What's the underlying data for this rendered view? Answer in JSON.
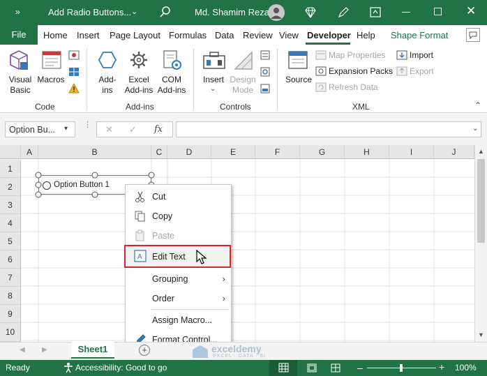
{
  "titlebar": {
    "doc_title": "Add Radio Buttons...",
    "user_name": "Md. Shamim Reza"
  },
  "ribbon_tabs": [
    "File",
    "Home",
    "Insert",
    "Page Layout",
    "Formulas",
    "Data",
    "Review",
    "View",
    "Developer",
    "Help",
    "Shape Format"
  ],
  "ribbon": {
    "code": {
      "group": "Code",
      "visual_basic": "Visual Basic",
      "macros": "Macros"
    },
    "addins": {
      "group": "Add-ins",
      "addins": "Add-ins",
      "excel_addins": "Excel Add-ins",
      "com_addins": "COM Add-ins"
    },
    "controls": {
      "group": "Controls",
      "insert": "Insert",
      "design_mode": "Design Mode"
    },
    "xml": {
      "group": "XML",
      "source": "Source",
      "map_properties": "Map Properties",
      "expansion_packs": "Expansion Packs",
      "refresh_data": "Refresh Data",
      "import": "Import",
      "export": "Export"
    }
  },
  "formula_bar": {
    "name_box": "Option Bu...",
    "fx": "fx",
    "value": ""
  },
  "columns": [
    "A",
    "B",
    "C",
    "D",
    "E",
    "F",
    "G",
    "H",
    "I",
    "J"
  ],
  "rows": [
    "1",
    "2",
    "3",
    "4",
    "5",
    "6",
    "7",
    "8",
    "9",
    "10"
  ],
  "control": {
    "label": "Option Button 1"
  },
  "context_menu": {
    "cut": "Cut",
    "copy": "Copy",
    "paste": "Paste",
    "edit_text": "Edit Text",
    "grouping": "Grouping",
    "order": "Order",
    "assign_macro": "Assign Macro...",
    "format_control": "Format Control..."
  },
  "sheet_tabs": [
    "Sheet1"
  ],
  "statusbar": {
    "ready": "Ready",
    "accessibility": "Accessibility: Good to go",
    "zoom": "100%"
  },
  "watermark": {
    "brand": "exceldemy",
    "tagline": "EXCEL · DATA · BI"
  },
  "colors": {
    "excel_green": "#217346",
    "highlight_red": "#e0242c"
  }
}
